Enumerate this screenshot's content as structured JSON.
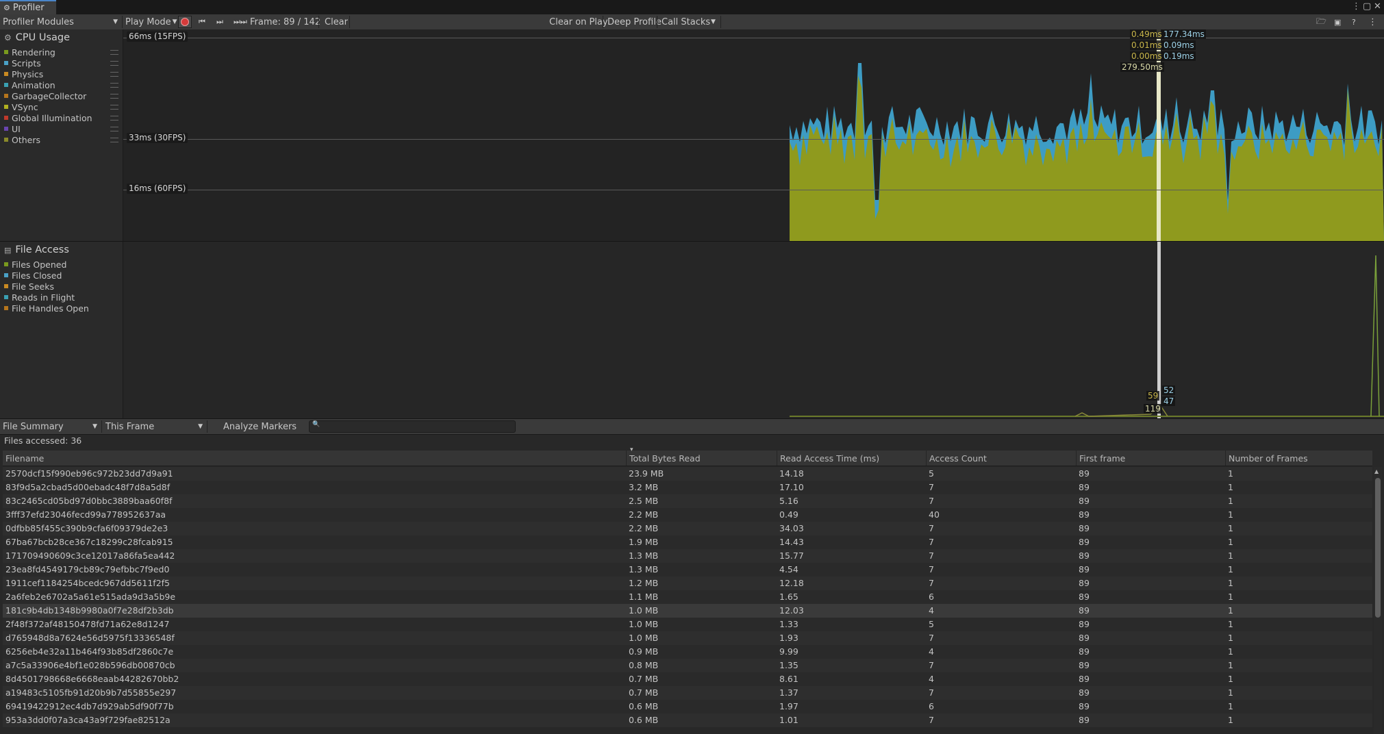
{
  "window": {
    "tab_title": "Profiler",
    "icons": [
      "more-icon",
      "maximize-icon",
      "close-icon"
    ]
  },
  "toolbar": {
    "modules_label": "Profiler Modules",
    "play_mode_label": "Play Mode",
    "frame_label": "Frame: 89 / 142",
    "clear_label": "Clear",
    "clear_on_play_label": "Clear on Play",
    "deep_profile_label": "Deep Profile",
    "call_stacks_label": "Call Stacks"
  },
  "cpu": {
    "title": "CPU Usage",
    "legend": [
      {
        "label": "Rendering",
        "color": "#7a9a1e"
      },
      {
        "label": "Scripts",
        "color": "#4aa1c6"
      },
      {
        "label": "Physics",
        "color": "#c98a22"
      },
      {
        "label": "Animation",
        "color": "#3aa0b2"
      },
      {
        "label": "GarbageCollector",
        "color": "#b5751c"
      },
      {
        "label": "VSync",
        "color": "#b0b020"
      },
      {
        "label": "Global Illumination",
        "color": "#c0392b"
      },
      {
        "label": "UI",
        "color": "#6a45b0"
      },
      {
        "label": "Others",
        "color": "#8a8a2a"
      }
    ],
    "fps_lines": [
      "66ms (15FPS)",
      "33ms (30FPS)",
      "16ms (60FPS)"
    ],
    "tooltip": {
      "left": [
        "0.49ms",
        "0.01ms",
        "0.00ms",
        "279.50ms"
      ],
      "right": [
        "177.34ms",
        "0.09ms",
        "0.19ms"
      ]
    }
  },
  "file_access": {
    "title": "File Access",
    "legend": [
      {
        "label": "Files Opened",
        "color": "#7a9a1e"
      },
      {
        "label": "Files Closed",
        "color": "#4aa1c6"
      },
      {
        "label": "File Seeks",
        "color": "#c98a22"
      },
      {
        "label": "Reads in Flight",
        "color": "#3aa0b2"
      },
      {
        "label": "File Handles Open",
        "color": "#b5751c"
      }
    ],
    "tooltip": {
      "a": "59",
      "b": "52",
      "c": "47",
      "d": "119"
    }
  },
  "summary_bar": {
    "view_label": "File Summary",
    "range_label": "This Frame",
    "analyze_label": "Analyze Markers",
    "search_placeholder": ""
  },
  "files_accessed": "Files accessed: 36",
  "table": {
    "columns": [
      "Filename",
      "Total Bytes Read",
      "Read Access Time (ms)",
      "Access Count",
      "First frame",
      "Number of Frames"
    ],
    "rows": [
      [
        "2570dcf15f990eb96c972b23dd7d9a91",
        "23.9 MB",
        "14.18",
        "5",
        "89",
        "1"
      ],
      [
        "83f9d5a2cbad5d00ebadc48f7d8a5d8f",
        "3.2 MB",
        "17.10",
        "7",
        "89",
        "1"
      ],
      [
        "83c2465cd05bd97d0bbc3889baa60f8f",
        "2.5 MB",
        "5.16",
        "7",
        "89",
        "1"
      ],
      [
        "3fff37efd23046fecd99a778952637aa",
        "2.2 MB",
        "0.49",
        "40",
        "89",
        "1"
      ],
      [
        "0dfbb85f455c390b9cfa6f09379de2e3",
        "2.2 MB",
        "34.03",
        "7",
        "89",
        "1"
      ],
      [
        "67ba67bcb28ce367c18299c28fcab915",
        "1.9 MB",
        "14.43",
        "7",
        "89",
        "1"
      ],
      [
        "171709490609c3ce12017a86fa5ea442",
        "1.3 MB",
        "15.77",
        "7",
        "89",
        "1"
      ],
      [
        "23ea8fd4549179cb89c79efbbc7f9ed0",
        "1.3 MB",
        "4.54",
        "7",
        "89",
        "1"
      ],
      [
        "1911cef1184254bcedc967dd5611f2f5",
        "1.2 MB",
        "12.18",
        "7",
        "89",
        "1"
      ],
      [
        "2a6feb2e6702a5a61e515ada9d3a5b9e",
        "1.1 MB",
        "1.65",
        "6",
        "89",
        "1"
      ],
      [
        "181c9b4db1348b9980a0f7e28df2b3db",
        "1.0 MB",
        "12.03",
        "4",
        "89",
        "1"
      ],
      [
        "2f48f372af48150478fd71a62e8d1247",
        "1.0 MB",
        "1.33",
        "5",
        "89",
        "1"
      ],
      [
        "d765948d8a7624e56d5975f13336548f",
        "1.0 MB",
        "1.93",
        "7",
        "89",
        "1"
      ],
      [
        "6256eb4e32a11b464f93b85df2860c7e",
        "0.9 MB",
        "9.99",
        "4",
        "89",
        "1"
      ],
      [
        "a7c5a33906e4bf1e028b596db00870cb",
        "0.8 MB",
        "1.35",
        "7",
        "89",
        "1"
      ],
      [
        "8d4501798668e6668eaab44282670bb2",
        "0.7 MB",
        "8.61",
        "4",
        "89",
        "1"
      ],
      [
        "a19483c5105fb91d20b9b7d55855e297",
        "0.7 MB",
        "1.37",
        "7",
        "89",
        "1"
      ],
      [
        "69419422912ec4db7d929ab5df90f77b",
        "0.6 MB",
        "1.97",
        "6",
        "89",
        "1"
      ],
      [
        "953a3dd0f07a3ca43a9f729fae82512a",
        "0.6 MB",
        "1.01",
        "7",
        "89",
        "1"
      ]
    ]
  },
  "colors": {
    "accent": "#4a85c9",
    "cpu_rendering": "#8f9a1e",
    "cpu_scripts": "#3d9cc4",
    "selected_frame": "#e8e8c8"
  }
}
